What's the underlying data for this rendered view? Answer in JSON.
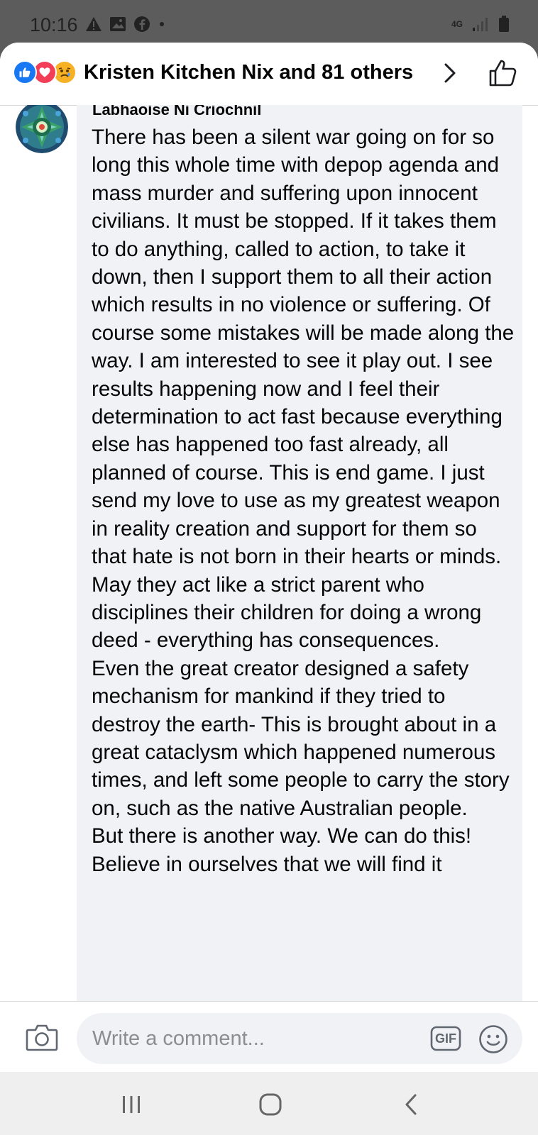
{
  "status_bar": {
    "time": "10:16",
    "network": "4G",
    "icons_left": [
      "warning-icon",
      "image-icon",
      "facebook-icon",
      "dot-icon"
    ],
    "icons_right": [
      "signal-icon",
      "battery-icon"
    ]
  },
  "header": {
    "reactions": [
      "like-reaction-icon",
      "love-reaction-icon",
      "sad-reaction-icon"
    ],
    "title": "Kristen Kitchen Nix and 81 others"
  },
  "comment": {
    "author": "Labhaoise Ni Criochnil",
    "paragraphs": [
      "There has been a silent war going on for so long this whole time with depop agenda and mass murder and suffering upon innocent civilians. It must be stopped. If it takes them to do anything, called to action, to take it down, then I support them to all their action which results in no violence or suffering. Of course some mistakes will be made along the way. I am interested to see it play out. I see results happening now and I feel their determination to act fast because everything else has happened too fast already, all planned of course. This is end game. I just send my love to use as my greatest weapon in reality creation and support for them so that hate is not born in their hearts or minds. May they act like a strict parent who disciplines their children for doing a wrong deed - everything has consequences.",
      "Even the great creator designed a safety mechanism for mankind if they tried to destroy the earth- This is brought about in a great cataclysm which happened numerous times, and left some people to carry the story on, such as the native Australian people.",
      "But there is another way. We can do this! Believe in ourselves that we will find it"
    ]
  },
  "composer": {
    "placeholder": "Write a comment...",
    "gif_label": "GIF"
  },
  "colors": {
    "facebook_blue": "#1877f2",
    "love_red": "#f33e58",
    "sad_yellow": "#f7b125",
    "bubble_bg": "#f0f2f5",
    "text": "#050505"
  }
}
